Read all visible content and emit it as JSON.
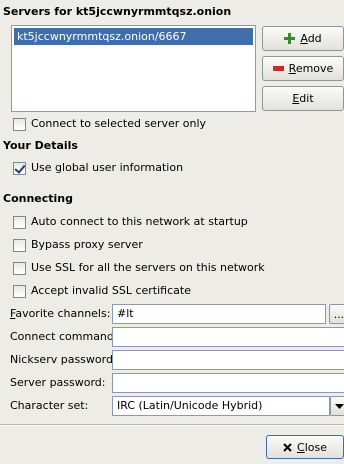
{
  "servers_heading": "Servers for kt5jccwnyrmmtqsz.onion",
  "server_list": [
    "kt5jccwnyrmmtqsz.onion/6667"
  ],
  "buttons": {
    "add": {
      "accel": "A",
      "rest": "dd"
    },
    "remove": {
      "accel": "R",
      "rest": "emove"
    },
    "edit": {
      "accel": "E",
      "rest": "dit"
    },
    "close": {
      "accel": "C",
      "rest": "lose"
    },
    "browse": "..."
  },
  "connect_selected_only": {
    "label": "Connect to selected server only",
    "checked": false
  },
  "your_details": {
    "heading": "Your Details",
    "use_global": {
      "label": "Use global user information",
      "checked": true
    }
  },
  "connecting": {
    "heading": "Connecting",
    "options": [
      {
        "label": "Auto connect to this network at startup",
        "checked": false
      },
      {
        "label": "Bypass proxy server",
        "checked": false
      },
      {
        "label": "Use SSL for all the servers on this network",
        "checked": false
      },
      {
        "label": "Accept invalid SSL certificate",
        "checked": false
      }
    ]
  },
  "fields": {
    "favorite_channels": {
      "accel": "F",
      "rest": "avorite channels:",
      "value": "#lt"
    },
    "connect_command": {
      "label": "Connect command:",
      "value": ""
    },
    "nickserv_password": {
      "label": "Nickserv password:",
      "value": ""
    },
    "server_password": {
      "label": "Server password:",
      "value": ""
    },
    "character_set": {
      "label": "Character set:",
      "value": "IRC (Latin/Unicode Hybrid)"
    }
  },
  "colors": {
    "selection": "#3f6eab",
    "add_icon": "#3a8a2a",
    "remove_icon": "#c0302a"
  },
  "icons": {
    "add": "plus-icon",
    "remove": "minus-icon",
    "close": "x-icon",
    "dropdown": "dropdown-arrow-icon"
  }
}
